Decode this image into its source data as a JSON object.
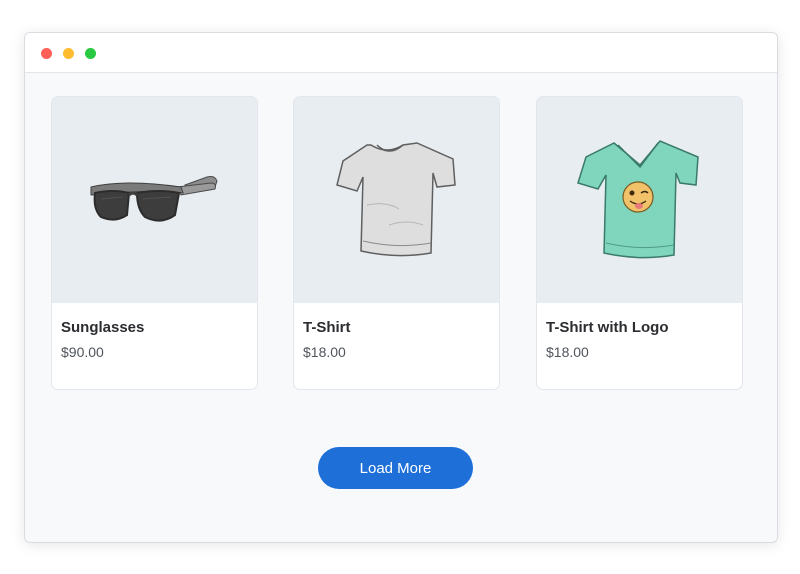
{
  "window": {
    "controls": [
      "close",
      "minimize",
      "maximize"
    ]
  },
  "products": [
    {
      "name": "Sunglasses",
      "price": "$90.00",
      "icon": "sunglasses-image"
    },
    {
      "name": "T-Shirt",
      "price": "$18.00",
      "icon": "tshirt-image"
    },
    {
      "name": "T-Shirt with Logo",
      "price": "$18.00",
      "icon": "tshirt-with-logo-image"
    }
  ],
  "load_more_label": "Load More",
  "colors": {
    "accent": "#1f6fd8",
    "card_image_bg": "#e8edf1",
    "page_bg": "#f7f9fb"
  }
}
